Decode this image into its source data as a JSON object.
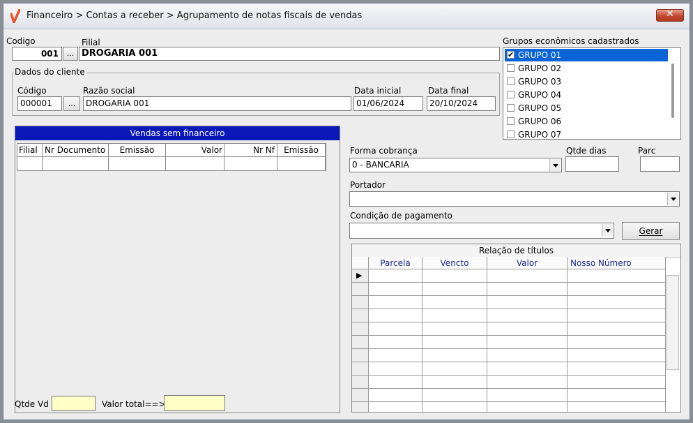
{
  "window": {
    "title": "Financeiro > Contas a receber > Agrupamento de notas fiscais de vendas",
    "close_glyph": "✕"
  },
  "header": {
    "codigo_label": "Codigo",
    "codigo_value": "001",
    "filial_label": "Filial",
    "filial_value": "DROGARIA 001",
    "browse_label": "..."
  },
  "cliente": {
    "group_label": "Dados do cliente",
    "codigo_label": "Código",
    "codigo_value": "000001",
    "razao_label": "Razão social",
    "razao_value": "DROGARIA 001",
    "data_inicial_label": "Data inicial",
    "data_inicial_value": "01/06/2024",
    "data_final_label": "Data final",
    "data_final_value": "20/10/2024"
  },
  "grupos": {
    "label": "Grupos econômicos cadastrados",
    "items": [
      {
        "label": "GRUPO 01",
        "checked": true,
        "selected": true
      },
      {
        "label": "GRUPO 02",
        "checked": false
      },
      {
        "label": "GRUPO 03",
        "checked": false
      },
      {
        "label": "GRUPO 04",
        "checked": false
      },
      {
        "label": "GRUPO 05",
        "checked": false
      },
      {
        "label": "GRUPO 06",
        "checked": false
      },
      {
        "label": "GRUPO 07",
        "checked": false
      }
    ]
  },
  "vendas": {
    "title": "Vendas sem financeiro",
    "columns": [
      "Filial",
      "Nr Documento",
      "Emissão",
      "Valor",
      "Nr Nf",
      "Emissão"
    ]
  },
  "footer": {
    "qtde_label": "Qtde Vd",
    "qtde_value": "",
    "valor_total_label": "Valor total==>",
    "valor_total_value": ""
  },
  "cobranca": {
    "forma_label": "Forma cobrança",
    "forma_value": "0 - BANCARIA",
    "qtde_dias_label": "Qtde dias",
    "qtde_dias_value": "",
    "parc_label": "Parc",
    "parc_value": "",
    "portador_label": "Portador",
    "portador_value": "",
    "condicao_label": "Condição de pagamento",
    "condicao_value": "",
    "gerar_label": "Gerar"
  },
  "titulos": {
    "title": "Relação de títulos",
    "columns": [
      "Parcela",
      "Vencto",
      "Valor",
      "Nosso Número"
    ],
    "current_row_glyph": "▶"
  },
  "colors": {
    "selection": "#0a64d6",
    "vendas_header": "#0a18b8",
    "titulos_header_text": "#1a2a8a",
    "footer_fields": "#ffffc8"
  }
}
